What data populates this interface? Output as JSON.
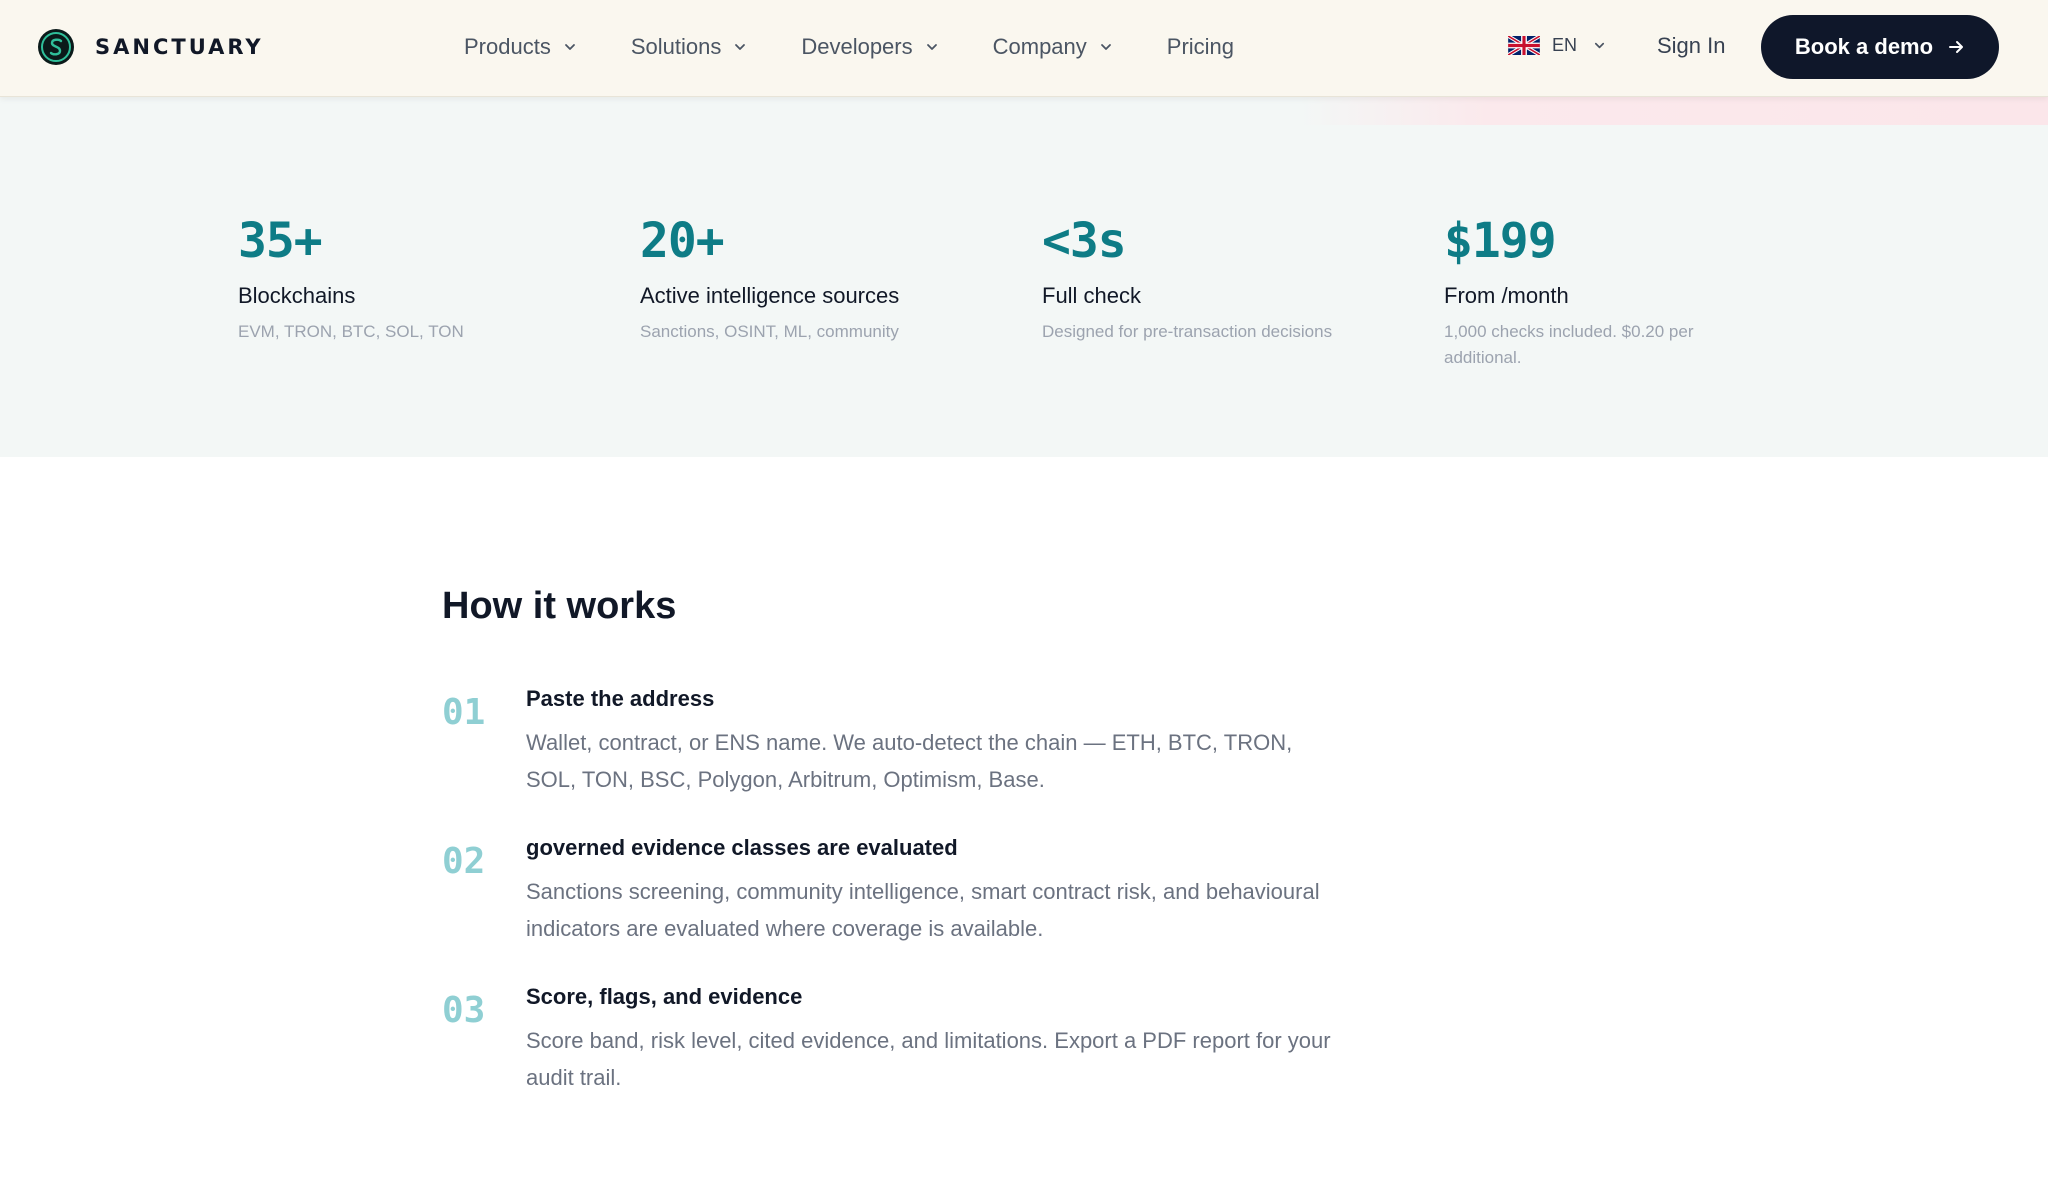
{
  "brand": {
    "name": "SANCTUARY",
    "accent": "#0e7c86",
    "dark": "#0f172a"
  },
  "nav": {
    "links": [
      {
        "label": "Products",
        "icon": "chevron-down-icon"
      },
      {
        "label": "Solutions",
        "icon": "chevron-down-icon"
      },
      {
        "label": "Developers",
        "icon": "chevron-down-icon"
      },
      {
        "label": "Company",
        "icon": "chevron-down-icon"
      },
      {
        "label": "Pricing"
      }
    ],
    "language": {
      "code": "EN",
      "icon": "uk-flag-icon"
    },
    "sign_in": "Sign In",
    "cta": {
      "label": "Book a demo",
      "icon": "arrow-right-icon"
    }
  },
  "stats": [
    {
      "value": "35+",
      "label": "Blockchains",
      "desc": "EVM, TRON, BTC, SOL, TON"
    },
    {
      "value": "20+",
      "label": "Active intelligence sources",
      "desc": "Sanctions, OSINT, ML, community"
    },
    {
      "value": "<3s",
      "label": "Full check",
      "desc": "Designed for pre-transaction decisions"
    },
    {
      "value": "$199",
      "label": "From /month",
      "desc": "1,000 checks included. $0.20 per additional."
    }
  ],
  "how_it_works": {
    "title": "How it works",
    "steps": [
      {
        "num": "01",
        "title": "Paste the address",
        "desc": "Wallet, contract, or ENS name. We auto-detect the chain — ETH, BTC, TRON, SOL, TON, BSC, Polygon, Arbitrum, Optimism, Base."
      },
      {
        "num": "02",
        "title": "governed evidence classes are evaluated",
        "desc": "Sanctions screening, community intelligence, smart contract risk, and behavioural indicators are evaluated where coverage is available."
      },
      {
        "num": "03",
        "title": "Score, flags, and evidence",
        "desc": "Score band, risk level, cited evidence, and limitations. Export a PDF report for your audit trail."
      }
    ]
  }
}
